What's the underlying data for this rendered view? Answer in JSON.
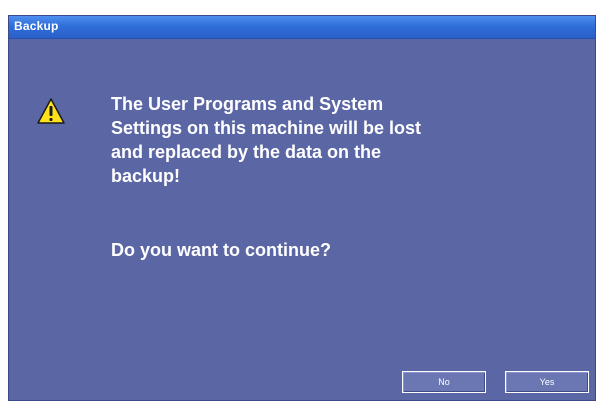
{
  "dialog": {
    "title": "Backup",
    "icon": "warning-icon",
    "message": "The User Programs and System\nSettings on this machine will be lost\nand replaced by the data on the\nbackup!",
    "question": "Do you want to continue?",
    "buttons": {
      "no_label": "No",
      "yes_label": "Yes"
    }
  },
  "colors": {
    "background": "#5b66a5",
    "titlebar": "#2f6fd9",
    "text": "#ffffff",
    "warning": "#ffe11a"
  }
}
